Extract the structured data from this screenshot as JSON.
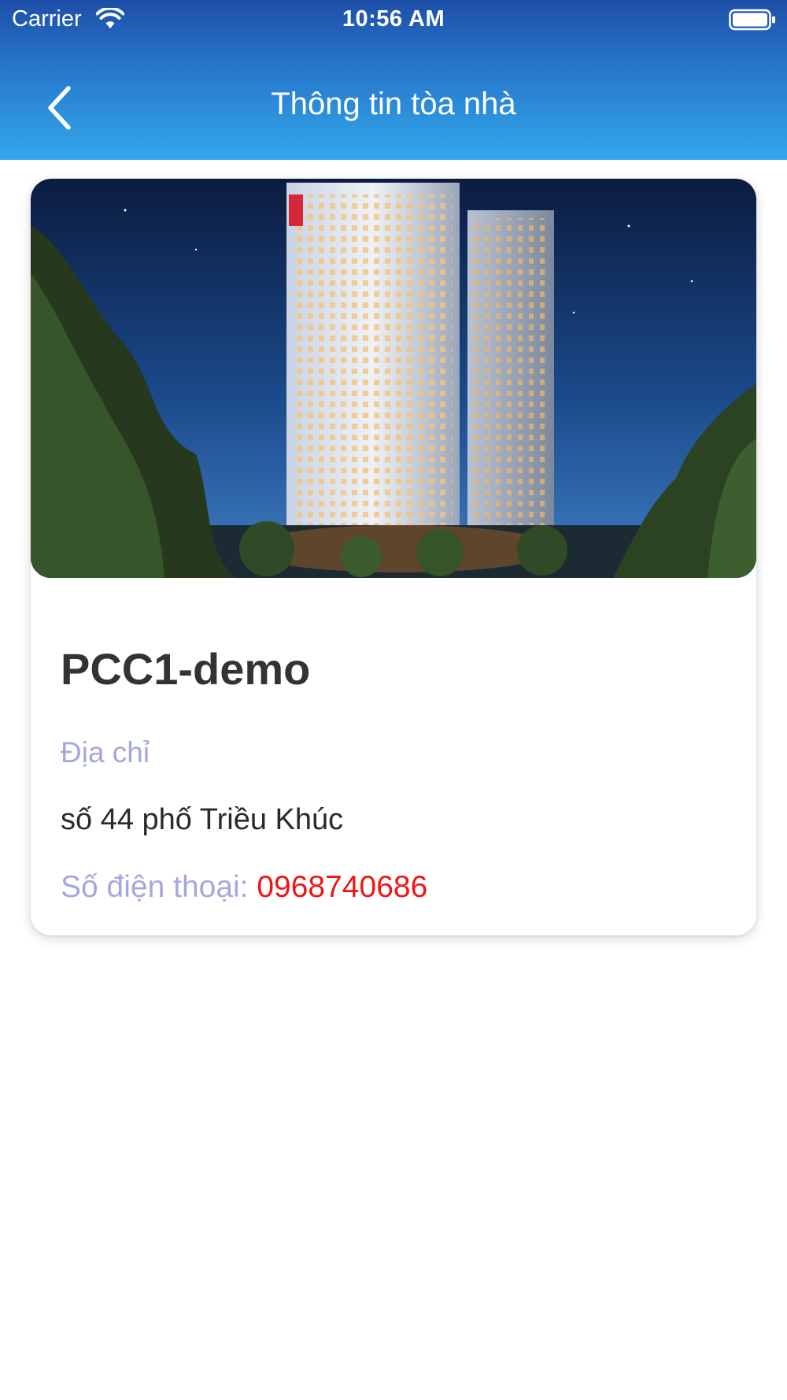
{
  "status_bar": {
    "carrier": "Carrier",
    "time": "10:56 AM"
  },
  "nav": {
    "title": "Thông tin tòa nhà",
    "back_icon": "chevron-left-icon"
  },
  "building": {
    "image_icon": "building-photo",
    "name": "PCC1-demo",
    "address_label": "Địa chỉ",
    "address": "số 44 phố Triều Khúc",
    "phone_label": "Số điện thoại: ",
    "phone": "0968740686"
  },
  "colors": {
    "header_top": "#1e4fa8",
    "header_bottom": "#33a8ec",
    "label": "#a4a8dc",
    "phone": "#f01515",
    "title_text": "#333333"
  }
}
